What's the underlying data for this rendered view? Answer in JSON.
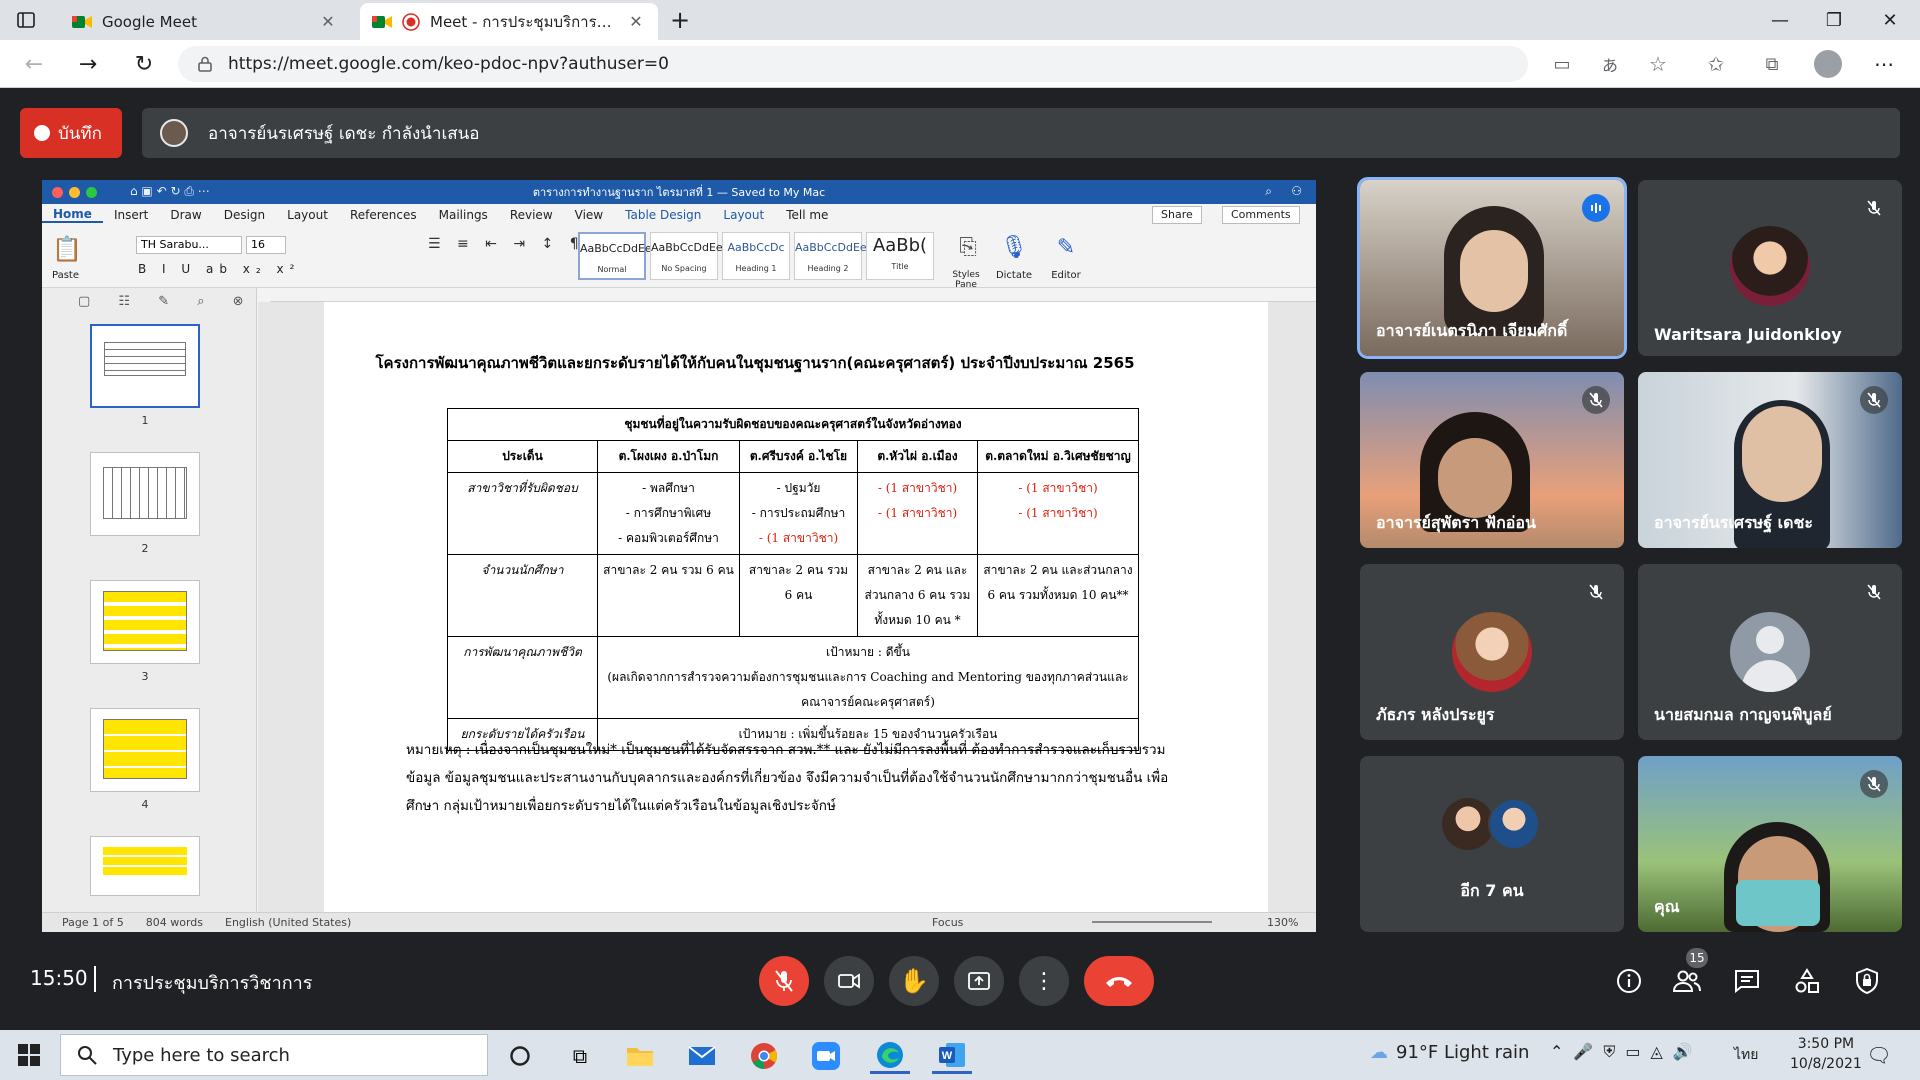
{
  "browser": {
    "tabs": [
      {
        "title": "Google Meet"
      },
      {
        "title": "Meet - การประชุมบริการวิชาการ"
      }
    ],
    "url": "https://meet.google.com/keo-pdoc-npv?authuser=0"
  },
  "meet": {
    "record_label": "บันทึก",
    "presenting": "อาจารย์นรเศรษฐ์ เดชะ กำลังนำเสนอ",
    "time": "15:50",
    "meeting_title": "การประชุมบริการวิชาการ",
    "people_count": "15",
    "colors": {
      "accent": "#8ab4f8",
      "end_call": "#ea4335",
      "record": "#d93025"
    }
  },
  "word": {
    "window_title": "ตารางการทำงานฐานราก ไตรมาสที่ 1 — Saved to My Mac",
    "tabs": [
      "Home",
      "Insert",
      "Draw",
      "Design",
      "Layout",
      "References",
      "Mailings",
      "Review",
      "View",
      "Table Design",
      "Layout",
      "Tell me"
    ],
    "share": "Share",
    "comments": "Comments",
    "font": "TH Sarabu...",
    "font_size": "16",
    "paste": "Paste",
    "styles": [
      {
        "sample": "AaBbCcDdEe",
        "name": "Normal"
      },
      {
        "sample": "AaBbCcDdEe",
        "name": "No Spacing"
      },
      {
        "sample": "AaBbCcDc",
        "name": "Heading 1"
      },
      {
        "sample": "AaBbCcDdEe",
        "name": "Heading 2"
      },
      {
        "sample": "AaBb(",
        "name": "Title"
      }
    ],
    "styles_pane": "Styles Pane",
    "dictate": "Dictate",
    "editor": "Editor",
    "thumbnails": [
      "1",
      "2",
      "3",
      "4"
    ],
    "status": {
      "page": "Page 1 of 5",
      "words": "804 words",
      "lang": "English (United States)",
      "focus": "Focus",
      "zoom": "130%"
    },
    "doc": {
      "title": "โครงการพัฒนาคุณภาพชีวิตและยกระดับรายได้ให้กับคนในชุมชนฐานราก(คณะครุศาสตร์) ประจำปีงบประมาณ 2565",
      "table": {
        "header_top": "ชุมชนที่อยู่ในความรับผิดชอบของคณะครุศาสตร์ในจังหวัดอ่างทอง",
        "columns": [
          "ประเด็น",
          "ต.โผงเผง อ.ป่าโมก",
          "ต.ศรีบรงค์ อ.ไชโย",
          "ต.หัวไผ่ อ.เมือง",
          "ต.ตลาดใหม่ อ.วิเศษชัยชาญ"
        ],
        "row1_label": "สาขาวิชาที่รับผิดชอบ",
        "row1": {
          "c1": [
            "- พลศึกษา",
            "- การศึกษาพิเศษ",
            "- คอมพิวเตอร์ศึกษา"
          ],
          "c2": [
            "- ปฐมวัย",
            "- การประถมศึกษา",
            "- (1 สาขาวิชา)"
          ],
          "c3": [
            "- (1 สาขาวิชา)",
            "- (1 สาขาวิชา)"
          ],
          "c4": [
            "- (1 สาขาวิชา)",
            "- (1 สาขาวิชา)"
          ]
        },
        "row2_label": "จำนวนนักศึกษา",
        "row2": {
          "c1": "สาขาละ 2 คน รวม 6 คน",
          "c2": "สาขาละ 2 คน รวม 6 คน",
          "c3": "สาขาละ 2 คน และส่วนกลาง 6 คน รวมทั้งหมด 10 คน *",
          "c4": "สาขาละ 2 คน และส่วนกลาง 6 คน รวมทั้งหมด 10 คน**"
        },
        "row3_label": "การพัฒนาคุณภาพชีวิต",
        "row3_goal": "เป้าหมาย : ดีขึ้น",
        "row3_detail": "(ผลเกิดจากการสำรวจความต้องการชุมชนและการ Coaching and Mentoring ของทุกภาคส่วนและ คณาจารย์คณะครุศาสตร์)",
        "row4_label": "ยกระดับรายได้ครัวเรือน",
        "row4_goal": "เป้าหมาย : เพิ่มขึ้นร้อยละ 15 ของจำนวนครัวเรือน"
      },
      "note": "หมายเหตุ : เนื่องจากเป็นชุมชนใหม่* เป็นชุมชนที่ได้รับจัดสรรจาก สวพ.** และ ยังไม่มีการลงพื้นที่ ต้องทำการสำรวจและเก็บรวบรวมข้อมูล ข้อมูลชุมชนและประสานงานกับบุคลากรและองค์กรที่เกี่ยวข้อง จึงมีความจำเป็นที่ต้องใช้จำนวนนักศึกษามากกว่าชุมชนอื่น เพื่อศึกษา กลุ่มเป้าหมายเพื่อยกระดับรายได้ในแต่ครัวเรือนในข้อมูลเชิงประจักษ์"
    }
  },
  "participants": [
    {
      "name": "อาจารย์เนตรนิภา เจียมศักดิ์",
      "mic": "on"
    },
    {
      "name": "Waritsara Juidonkloy",
      "mic": "off"
    },
    {
      "name": "อาจารย์สุพัตรา ฟักอ่อน",
      "mic": "off"
    },
    {
      "name": "อาจารย์นรเศรษฐ์ เดชะ",
      "mic": "off"
    },
    {
      "name": "ภัธภร หลังประยูร",
      "mic": "off"
    },
    {
      "name": "นายสมกมล กาญจนพิบูลย์",
      "mic": "off"
    },
    {
      "name": "อีก 7 คน",
      "mic": ""
    },
    {
      "name": "คุณ",
      "mic": "off"
    }
  ],
  "taskbar": {
    "search_placeholder": "Type here to search",
    "weather": "91°F  Light rain",
    "lang": "ไทย",
    "time": "3:50 PM",
    "date": "10/8/2021"
  }
}
